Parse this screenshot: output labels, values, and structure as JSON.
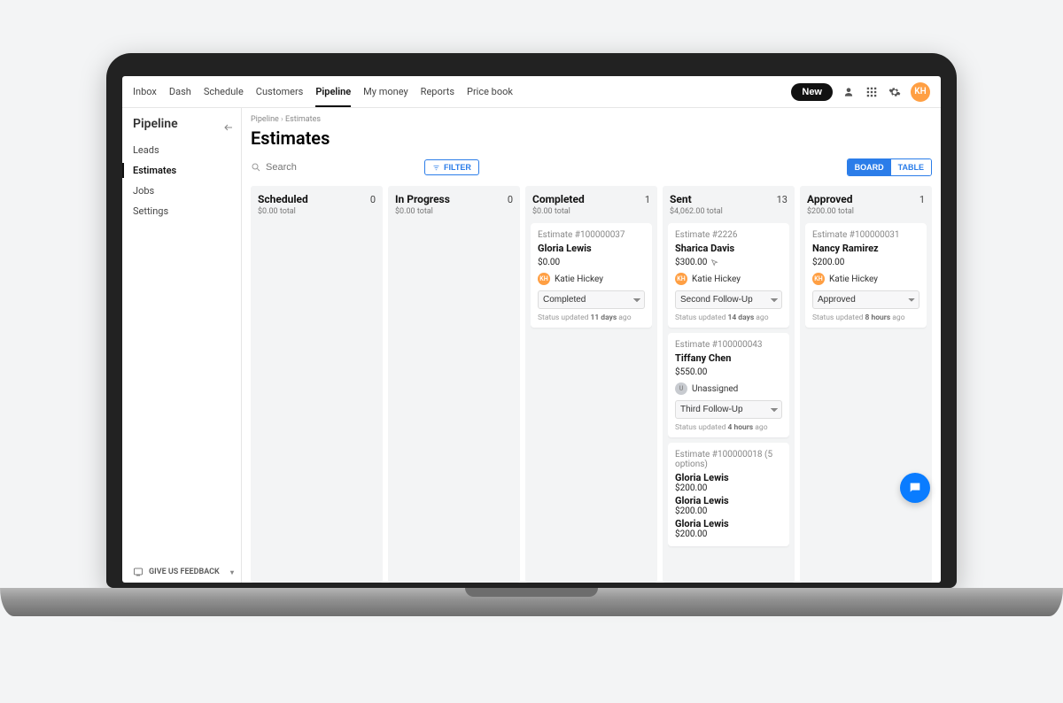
{
  "nav": {
    "items": [
      "Inbox",
      "Dash",
      "Schedule",
      "Customers",
      "Pipeline",
      "My money",
      "Reports",
      "Price book"
    ],
    "active": "Pipeline",
    "new_label": "New",
    "avatar": "KH"
  },
  "sidebar": {
    "title": "Pipeline",
    "items": [
      "Leads",
      "Estimates",
      "Jobs",
      "Settings"
    ],
    "active": "Estimates",
    "feedback_label": "GIVE US FEEDBACK"
  },
  "breadcrumb": [
    "Pipeline",
    "Estimates"
  ],
  "page_title": "Estimates",
  "search_placeholder": "Search",
  "filter_label": "FILTER",
  "view_toggle": {
    "board": "BOARD",
    "table": "TABLE",
    "active": "board"
  },
  "columns": [
    {
      "title": "Scheduled",
      "count": 0,
      "total": "$0.00 total",
      "cards": []
    },
    {
      "title": "In Progress",
      "count": 0,
      "total": "$0.00 total",
      "cards": []
    },
    {
      "title": "Completed",
      "count": 1,
      "total": "$0.00 total",
      "cards": [
        {
          "id": "Estimate #100000037",
          "customer": "Gloria Lewis",
          "amount": "$0.00",
          "assignee": "Katie Hickey",
          "assignee_av": "KH",
          "status": "Completed",
          "updated_prefix": "Status updated ",
          "updated_time": "11 days",
          "updated_suffix": " ago"
        }
      ]
    },
    {
      "title": "Sent",
      "count": 13,
      "total": "$4,062.00 total",
      "cards": [
        {
          "id": "Estimate #2226",
          "customer": "Sharica Davis",
          "amount": "$300.00",
          "cursor": true,
          "assignee": "Katie Hickey",
          "assignee_av": "KH",
          "status": "Second Follow-Up",
          "updated_prefix": "Status updated ",
          "updated_time": "14 days",
          "updated_suffix": " ago"
        },
        {
          "id": "Estimate #100000043",
          "customer": "Tiffany Chen",
          "amount": "$550.00",
          "assignee": "Unassigned",
          "assignee_av": "U",
          "unassigned": true,
          "status": "Third Follow-Up",
          "updated_prefix": "Status updated ",
          "updated_time": "4 hours",
          "updated_suffix": " ago"
        },
        {
          "id": "Estimate #100000018 (5 options)",
          "multi": true,
          "entries": [
            {
              "customer": "Gloria Lewis",
              "amount": "$200.00"
            },
            {
              "customer": "Gloria Lewis",
              "amount": "$200.00"
            },
            {
              "customer": "Gloria Lewis",
              "amount": "$200.00"
            }
          ]
        }
      ]
    },
    {
      "title": "Approved",
      "count": 1,
      "total": "$200.00 total",
      "cards": [
        {
          "id": "Estimate #100000031",
          "customer": "Nancy Ramirez",
          "amount": "$200.00",
          "assignee": "Katie Hickey",
          "assignee_av": "KH",
          "status": "Approved",
          "updated_prefix": "Status updated ",
          "updated_time": "8 hours",
          "updated_suffix": " ago"
        }
      ]
    }
  ]
}
